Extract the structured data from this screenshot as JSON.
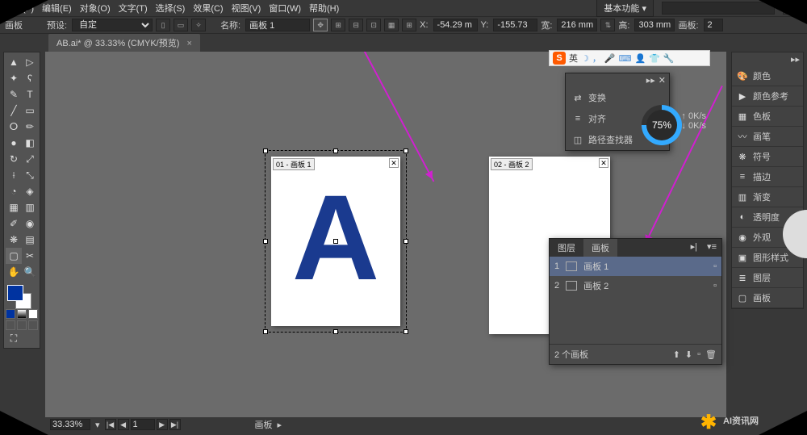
{
  "menu": {
    "file": "文件(F)",
    "edit": "编辑(E)",
    "object": "对象(O)",
    "type": "文字(T)",
    "select": "选择(S)",
    "effect": "效果(C)",
    "view": "视图(V)",
    "window": "窗口(W)",
    "help": "帮助(H)",
    "basic": "基本功能 ▾"
  },
  "ctrl": {
    "artboard": "画板",
    "preset": "预设:",
    "preset_val": "自定",
    "name": "名称:",
    "name_val": "画板 1",
    "x_lbl": "X:",
    "x_val": "-54.29 m",
    "y_lbl": "Y:",
    "y_val": "-155.73",
    "w_lbl": "宽:",
    "w_val": "216 mm",
    "h_lbl": "高:",
    "h_val": "303 mm",
    "ab_lbl": "画板:",
    "ab_val": "2"
  },
  "tab": {
    "title": "AB.ai* @ 33.33% (CMYK/预览)",
    "x": "×"
  },
  "artboards": {
    "ab1": "01 - 画板 1",
    "ab2": "02 - 画板 2",
    "letter": "A"
  },
  "fp1": {
    "transform": "变换",
    "align": "对齐",
    "pathfinder": "路径查找器"
  },
  "fp2": {
    "tab1": "图层",
    "tab2": "画板",
    "item1": "画板 1",
    "item2": "画板 2",
    "n1": "1",
    "n2": "2",
    "count": "2 个画板"
  },
  "right": {
    "color": "颜色",
    "colorref": "颜色参考",
    "swatches": "色板",
    "brushes": "画笔",
    "symbols": "符号",
    "stroke": "描边",
    "gradient": "渐变",
    "transparency": "透明度",
    "appearance": "外观",
    "graphicstyles": "图形样式",
    "layers": "图层",
    "artboards": "画板"
  },
  "progress": {
    "pct": "75%",
    "up": "0K/s",
    "dn": "0K/s"
  },
  "ime": {
    "lang": "英"
  },
  "status": {
    "zoom": "33.33%",
    "page": "1",
    "tool": "画板"
  },
  "watermark": "AI资讯网"
}
